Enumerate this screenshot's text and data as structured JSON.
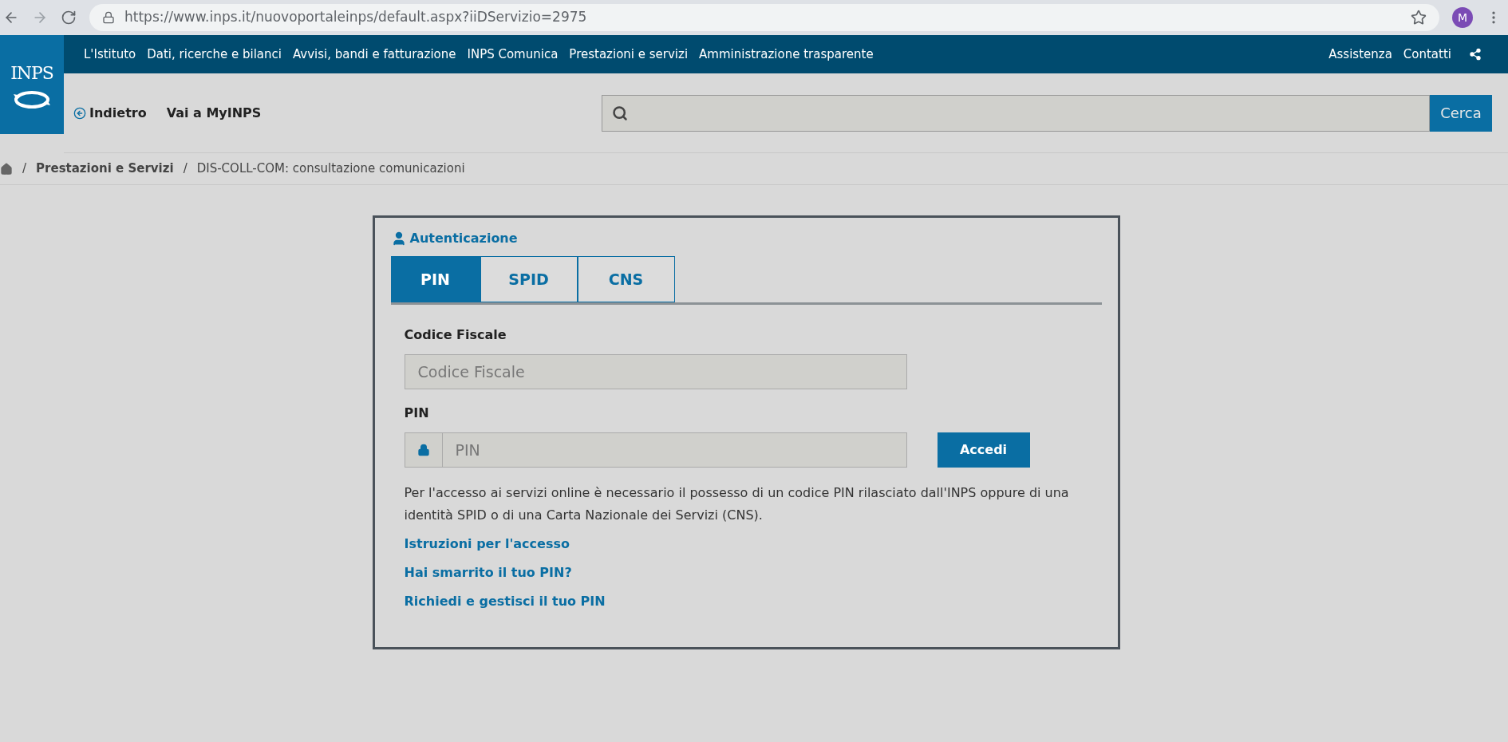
{
  "browser": {
    "url": "https://www.inps.it/nuovoportaleinps/default.aspx?iiDServizio=2975",
    "avatar": "M"
  },
  "logo": "INPS",
  "nav": {
    "items": [
      "L'Istituto",
      "Dati, ricerche e bilanci",
      "Avvisi, bandi e fatturazione",
      "INPS Comunica",
      "Prestazioni e servizi",
      "Amministrazione trasparente"
    ],
    "right_items": [
      "Assistenza",
      "Contatti"
    ]
  },
  "subheader": {
    "back": "Indietro",
    "myinps": "Vai a MyINPS",
    "search_button": "Cerca"
  },
  "breadcrumb": {
    "separator": "/",
    "items": [
      "Prestazioni e Servizi",
      "DIS-COLL-COM: consultazione comunicazioni"
    ]
  },
  "auth": {
    "title": "Autenticazione",
    "tabs": [
      {
        "label": "PIN",
        "selected": true
      },
      {
        "label": "SPID",
        "selected": false
      },
      {
        "label": "CNS",
        "selected": false
      }
    ],
    "fiscal_code": {
      "label": "Codice Fiscale",
      "placeholder": "Codice Fiscale"
    },
    "pin": {
      "label": "PIN",
      "placeholder": "PIN"
    },
    "submit": "Accedi",
    "info": "Per l'accesso ai servizi online è necessario il possesso di un codice PIN rilasciato dall'INPS oppure di una identità SPID o di una Carta Nazionale dei Servizi (CNS).",
    "links": [
      "Istruzioni per l'accesso",
      "Hai smarrito il tuo PIN?",
      "Richiedi e gestisci il tuo PIN"
    ]
  }
}
